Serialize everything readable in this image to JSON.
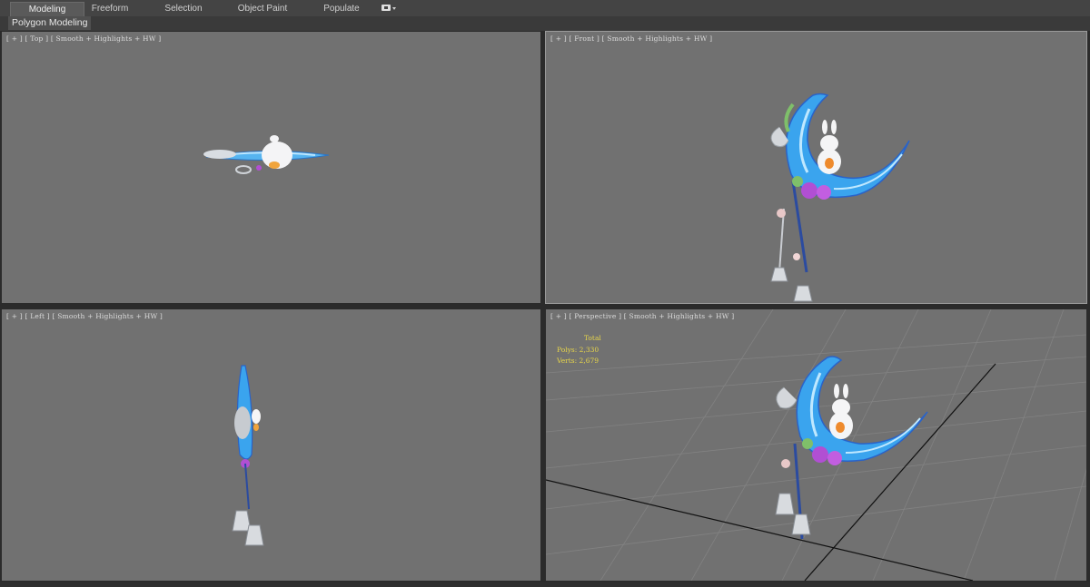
{
  "ribbon": {
    "tabs": [
      {
        "label": "Modeling",
        "active": true
      },
      {
        "label": "Freeform",
        "active": false
      },
      {
        "label": "Selection",
        "active": false
      },
      {
        "label": "Object Paint",
        "active": false
      },
      {
        "label": "Populate",
        "active": false
      }
    ],
    "menu_icon": "camera-dropdown-icon"
  },
  "subbar": {
    "active_panel": "Polygon Modeling"
  },
  "viewports": {
    "top": {
      "label": "[ + ] [ Top ] [ Smooth + Highlights + HW ]"
    },
    "front": {
      "label": "[ + ] [ Front ] [ Smooth + Highlights + HW ]"
    },
    "left": {
      "label": "[ + ] [ Left ] [ Smooth + Highlights + HW ]"
    },
    "perspective": {
      "label": "[ + ] [ Perspective ] [ Smooth + Highlights + HW ]",
      "stats": {
        "header": "Total",
        "polys_label": "Polys:",
        "polys_value": "2,330",
        "verts_label": "Verts:",
        "verts_value": "2,679"
      }
    }
  },
  "colors": {
    "viewport_bg": "#717171",
    "viewport_border_active": "#9a9a9a",
    "stats_text": "#e8d64a",
    "moon_blue": "#3aa4ee",
    "flower_purple": "#b14fd3"
  },
  "model": {
    "name": "moon staff with rabbit"
  }
}
